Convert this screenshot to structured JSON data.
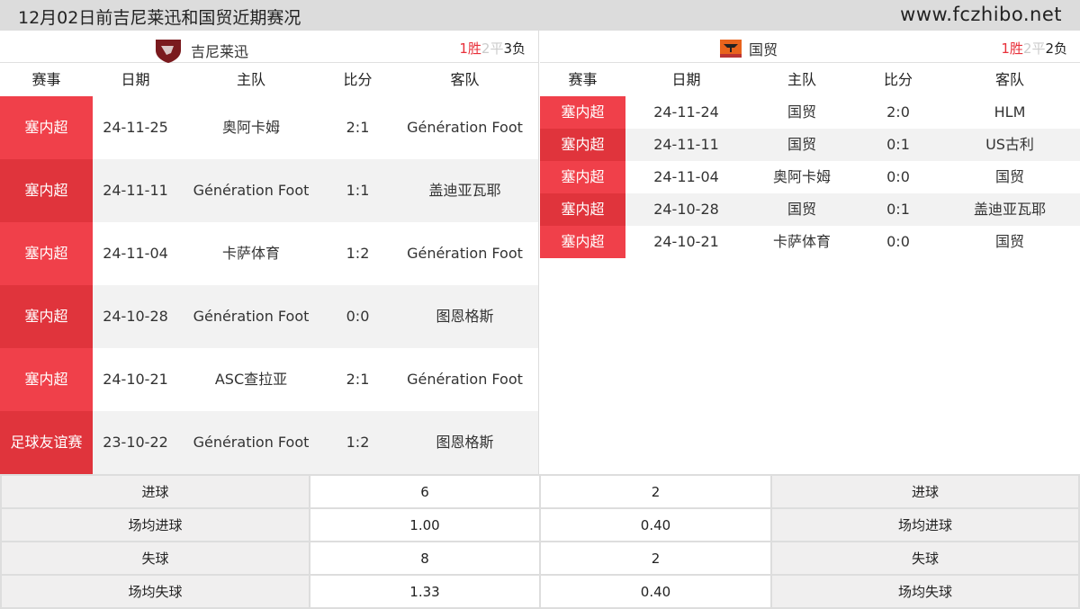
{
  "header": {
    "title": "12月02日前吉尼莱迅和国贸近期赛况",
    "site": "www.fczhibo.net"
  },
  "columns": [
    "赛事",
    "日期",
    "主队",
    "比分",
    "客队"
  ],
  "left": {
    "team": "吉尼莱迅",
    "logo_color": "#7a1a1e",
    "record": {
      "w": "1胜",
      "d": "2平",
      "l": "3负"
    },
    "matches": [
      {
        "league": "塞内超",
        "date": "24-11-25",
        "home": "奥阿卡姆",
        "score": "2:1",
        "away": "Génération Foot"
      },
      {
        "league": "塞内超",
        "date": "24-11-11",
        "home": "Génération Foot",
        "score": "1:1",
        "away": "盖迪亚瓦耶"
      },
      {
        "league": "塞内超",
        "date": "24-11-04",
        "home": "卡萨体育",
        "score": "1:2",
        "away": "Génération Foot"
      },
      {
        "league": "塞内超",
        "date": "24-10-28",
        "home": "Génération Foot",
        "score": "0:0",
        "away": "图恩格斯"
      },
      {
        "league": "塞内超",
        "date": "24-10-21",
        "home": "ASC查拉亚",
        "score": "2:1",
        "away": "Génération Foot"
      },
      {
        "league": "足球友谊赛",
        "date": "23-10-22",
        "home": "Génération Foot",
        "score": "1:2",
        "away": "图恩格斯"
      }
    ]
  },
  "right": {
    "team": "国贸",
    "logo_color": "#e8631c",
    "record": {
      "w": "1胜",
      "d": "2平",
      "l": "2负"
    },
    "matches": [
      {
        "league": "塞内超",
        "date": "24-11-24",
        "home": "国贸",
        "score": "2:0",
        "away": "HLM"
      },
      {
        "league": "塞内超",
        "date": "24-11-11",
        "home": "国贸",
        "score": "0:1",
        "away": "US古利"
      },
      {
        "league": "塞内超",
        "date": "24-11-04",
        "home": "奥阿卡姆",
        "score": "0:0",
        "away": "国贸"
      },
      {
        "league": "塞内超",
        "date": "24-10-28",
        "home": "国贸",
        "score": "0:1",
        "away": "盖迪亚瓦耶"
      },
      {
        "league": "塞内超",
        "date": "24-10-21",
        "home": "卡萨体育",
        "score": "0:0",
        "away": "国贸"
      }
    ]
  },
  "stats": [
    {
      "label": "进球",
      "left": "6",
      "right": "2"
    },
    {
      "label": "场均进球",
      "left": "1.00",
      "right": "0.40"
    },
    {
      "label": "失球",
      "left": "8",
      "right": "2"
    },
    {
      "label": "场均失球",
      "left": "1.33",
      "right": "0.40"
    }
  ]
}
